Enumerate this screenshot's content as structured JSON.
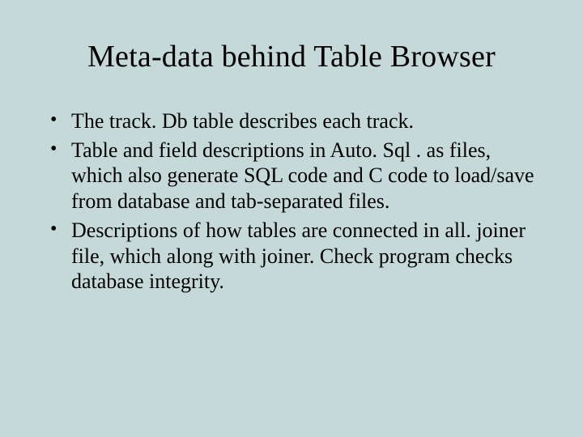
{
  "slide": {
    "title": "Meta-data behind Table Browser",
    "bullets": [
      "The track. Db table describes each track.",
      "Table and field descriptions in Auto. Sql . as files,  which also generate SQL code and C code to load/save from database and tab-separated files.",
      "Descriptions of how tables are connected in all. joiner file, which along with joiner. Check program checks database integrity."
    ]
  }
}
